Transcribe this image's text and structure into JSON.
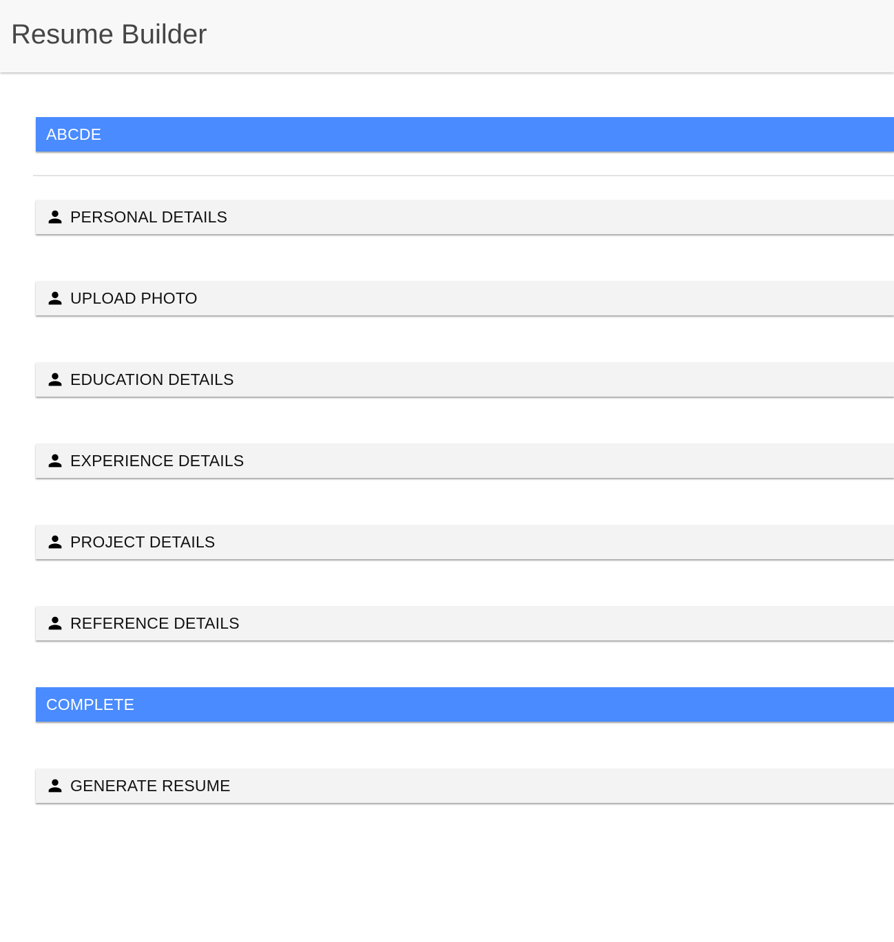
{
  "app": {
    "title": "Resume Builder"
  },
  "colors": {
    "accent": "#4a8bff",
    "app_bar": "#f8f8f8",
    "item_bg": "#f3f3f3"
  },
  "sections": {
    "header_top": "ABCDE",
    "items": [
      {
        "label": "PERSONAL DETAILS",
        "icon": "person-icon"
      },
      {
        "label": "UPLOAD PHOTO",
        "icon": "person-icon"
      },
      {
        "label": "EDUCATION DETAILS",
        "icon": "person-icon"
      },
      {
        "label": "EXPERIENCE DETAILS",
        "icon": "person-icon"
      },
      {
        "label": "PROJECT DETAILS",
        "icon": "person-icon"
      },
      {
        "label": "REFERENCE DETAILS",
        "icon": "person-icon"
      }
    ],
    "header_bottom": "COMPLETE",
    "final_items": [
      {
        "label": "GENERATE RESUME",
        "icon": "person-icon"
      }
    ]
  }
}
